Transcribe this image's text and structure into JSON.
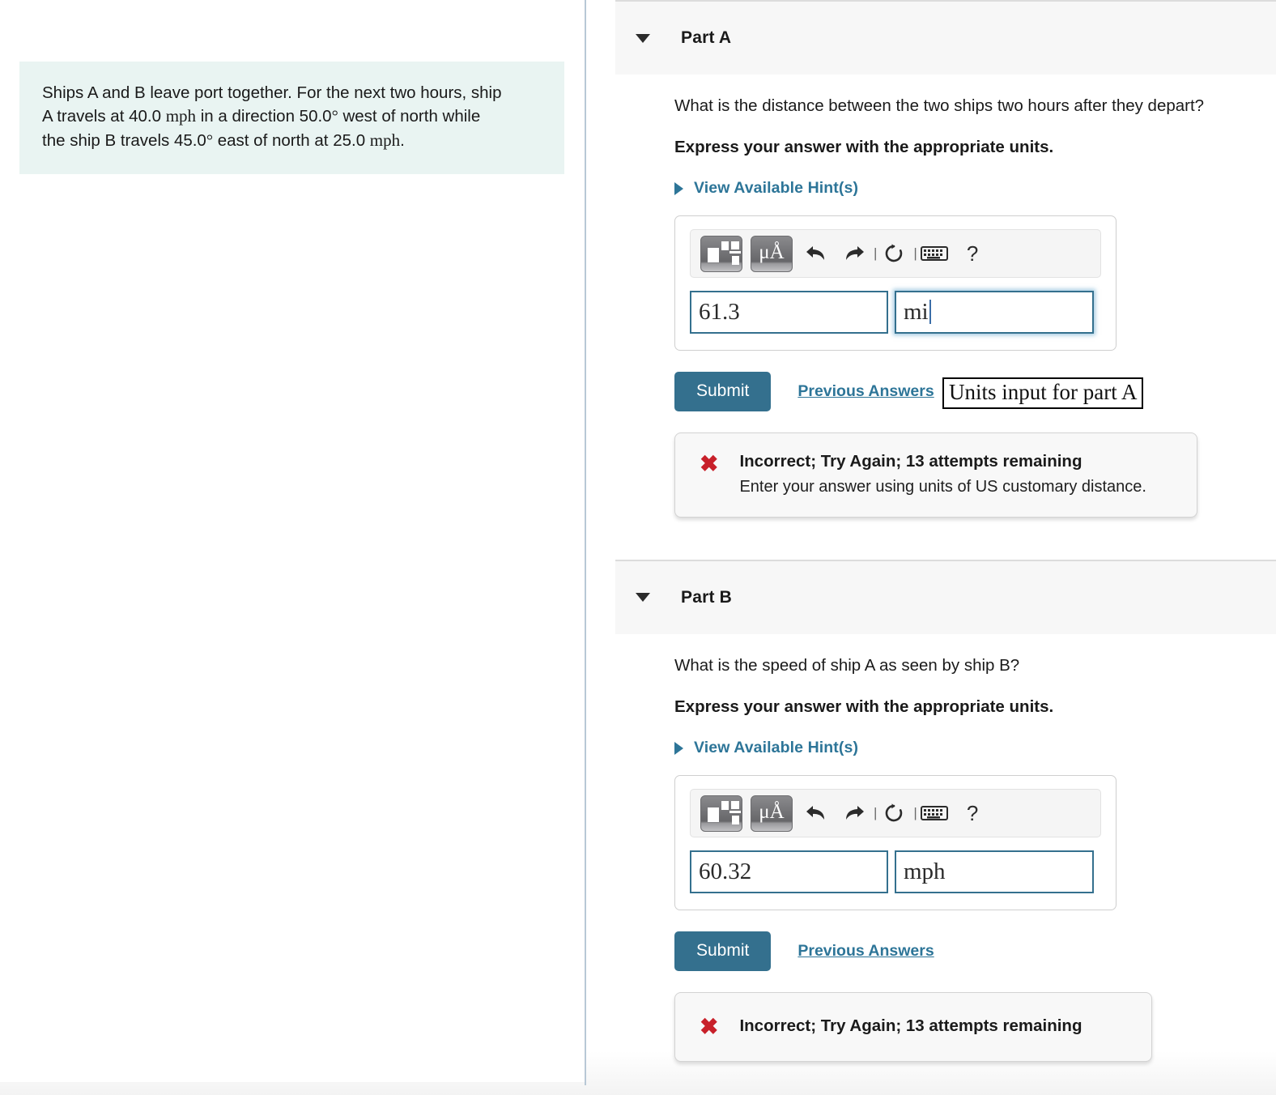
{
  "problem": {
    "text_line1": "Ships A and B leave port together. For the next two hours, ship",
    "text_line2_a": "A travels at 40.0 ",
    "text_line2_unit": "mph",
    "text_line2_b": " in a direction 50.0",
    "text_line2_deg": "°",
    "text_line2_c": " west of north while",
    "text_line3_a": "the ship B travels 45.0",
    "text_line3_deg": "°",
    "text_line3_b": " east of north at 25.0 ",
    "text_line3_unit": "mph",
    "text_line3_c": "."
  },
  "toolbar": {
    "template_icon": "math-template-icon",
    "units_button_label": "μÅ",
    "undo_icon": "undo-arrow-icon",
    "redo_icon": "redo-arrow-icon",
    "reset_icon": "reset-circular-arrow-icon",
    "keyboard_icon": "keyboard-icon",
    "help_label": "?"
  },
  "tooltip": {
    "text": "Units input for part A"
  },
  "colors": {
    "accent_blue": "#34708e",
    "link_blue": "#2d7598",
    "error_red": "#c8202a",
    "statement_bg": "#e9f4f2",
    "header_bg": "#f7f7f7",
    "divider": "#b8c8d6"
  },
  "parts": [
    {
      "id": "part-a",
      "title": "Part A",
      "question": "What is the distance between the two ships two hours after they depart?",
      "express": "Express your answer with the appropriate units.",
      "hints_label": "View Available Hint(s)",
      "value": "61.3",
      "units": "mi",
      "submit_label": "Submit",
      "previous_answers_label": "Previous Answers",
      "feedback_title": "Incorrect; Try Again; 13 attempts remaining",
      "feedback_detail": "Enter your answer using units of US customary distance.",
      "feedback_icon": "red-x-icon"
    },
    {
      "id": "part-b",
      "title": "Part B",
      "question": "What is the speed of ship A as seen by ship B?",
      "express": "Express your answer with the appropriate units.",
      "hints_label": "View Available Hint(s)",
      "value": "60.32",
      "units": "mph",
      "submit_label": "Submit",
      "previous_answers_label": "Previous Answers",
      "feedback_title": "Incorrect; Try Again; 13 attempts remaining",
      "feedback_detail": "",
      "feedback_icon": "red-x-icon"
    }
  ]
}
